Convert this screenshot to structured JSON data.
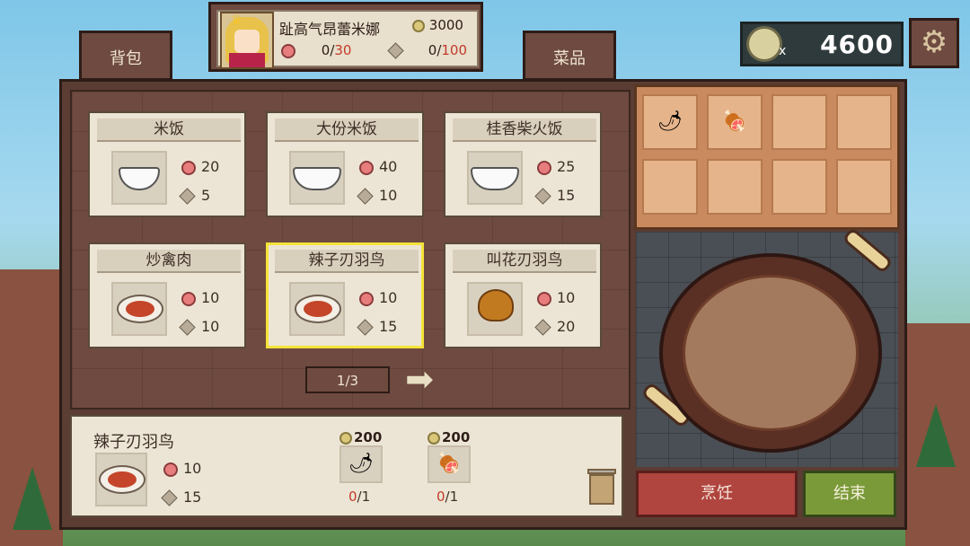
{
  "tabs": {
    "bag": "背包",
    "dishes": "菜品"
  },
  "character": {
    "name": "趾高气昂蕾米娜",
    "coins": "3000",
    "satisfaction": {
      "current": "0",
      "max": "30"
    },
    "diamond": {
      "current": "0",
      "max": "100"
    }
  },
  "money": {
    "multiplier": "x",
    "value": "4600"
  },
  "dishes": [
    {
      "name": "米饭",
      "satisfaction": "20",
      "price": "5"
    },
    {
      "name": "大份米饭",
      "satisfaction": "40",
      "price": "10"
    },
    {
      "name": "桂香柴火饭",
      "satisfaction": "25",
      "price": "15"
    },
    {
      "name": "炒禽肉",
      "satisfaction": "10",
      "price": "10"
    },
    {
      "name": "辣子刃羽鸟",
      "satisfaction": "10",
      "price": "15"
    },
    {
      "name": "叫花刃羽鸟",
      "satisfaction": "10",
      "price": "20"
    }
  ],
  "pager": {
    "label": "1/3"
  },
  "detail": {
    "name": "辣子刃羽鸟",
    "satisfaction": "10",
    "price": "15",
    "ingredients": [
      {
        "icon": "chili-pepper-icon",
        "glyph": "🌶",
        "cost": "200",
        "have": "0",
        "need": "/1"
      },
      {
        "icon": "meat-icon",
        "glyph": "🍖",
        "cost": "200",
        "have": "0",
        "need": "/1"
      }
    ]
  },
  "pantry": {
    "slots": [
      {
        "glyph": "🌶"
      },
      {
        "glyph": "🍖"
      }
    ]
  },
  "buttons": {
    "cook": "烹饪",
    "end": "结束"
  },
  "colors": {
    "selected_border": "#f5e23a",
    "cook": "#b0443e",
    "end": "#7a9a3a",
    "deficit": "#c23a2a"
  }
}
